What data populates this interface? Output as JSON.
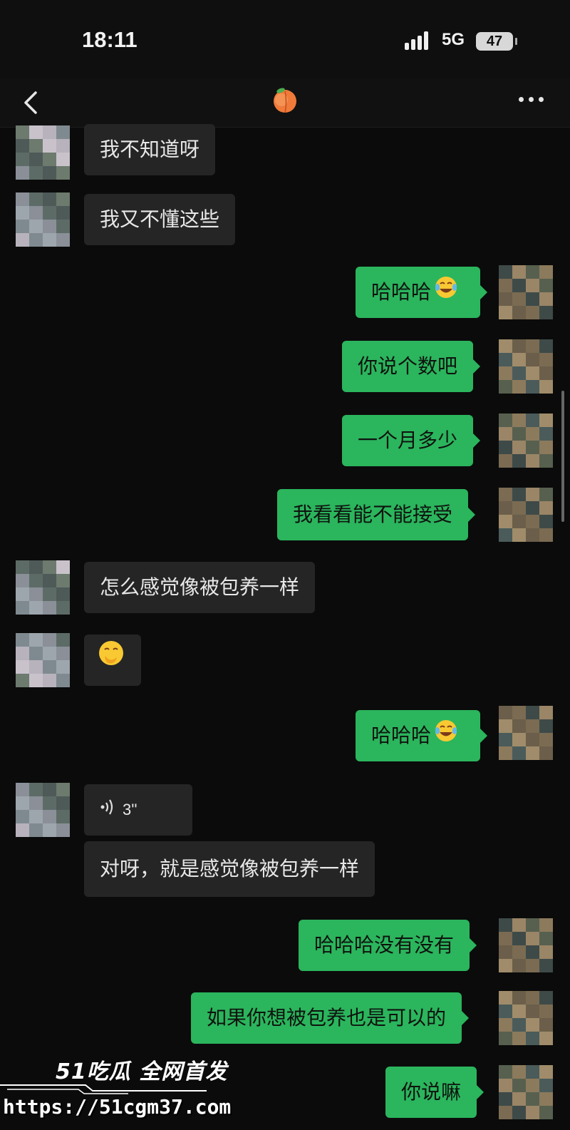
{
  "status_bar": {
    "time": "18:11",
    "network": "5G",
    "battery": "47"
  },
  "nav": {
    "title_icon": "peach-emoji-icon",
    "back_icon": "back-chevron-icon",
    "more_icon": "more-dots-icon"
  },
  "messages": [
    {
      "side": "in",
      "text": "我不知道呀"
    },
    {
      "side": "in",
      "text": "我又不懂这些"
    },
    {
      "side": "out",
      "text": "哈哈哈",
      "emoji": "laugh-cry-emoji-icon"
    },
    {
      "side": "out",
      "text": "你说个数吧"
    },
    {
      "side": "out",
      "text": "一个月多少"
    },
    {
      "side": "out",
      "text": "我看看能不能接受"
    },
    {
      "side": "in",
      "text": "怎么感觉像被包养一样"
    },
    {
      "side": "in",
      "text": "",
      "emoji": "hand-over-mouth-emoji-icon"
    },
    {
      "side": "out",
      "text": "哈哈哈",
      "emoji": "laugh-cry-emoji-icon"
    },
    {
      "side": "in",
      "voice_duration": "3''"
    },
    {
      "side": "in",
      "text": "对呀，就是感觉像被包养一样"
    },
    {
      "side": "out",
      "text": "哈哈哈没有没有"
    },
    {
      "side": "out",
      "text": "如果你想被包养也是可以的"
    },
    {
      "side": "out",
      "text": "你说嘛"
    }
  ],
  "watermark": {
    "brand": "51吃瓜 全网首发",
    "url": "https://51cgm37.com"
  },
  "colors": {
    "background": "#0b0b0b",
    "incoming_bubble": "#252525",
    "outgoing_bubble": "#2bb55d"
  }
}
